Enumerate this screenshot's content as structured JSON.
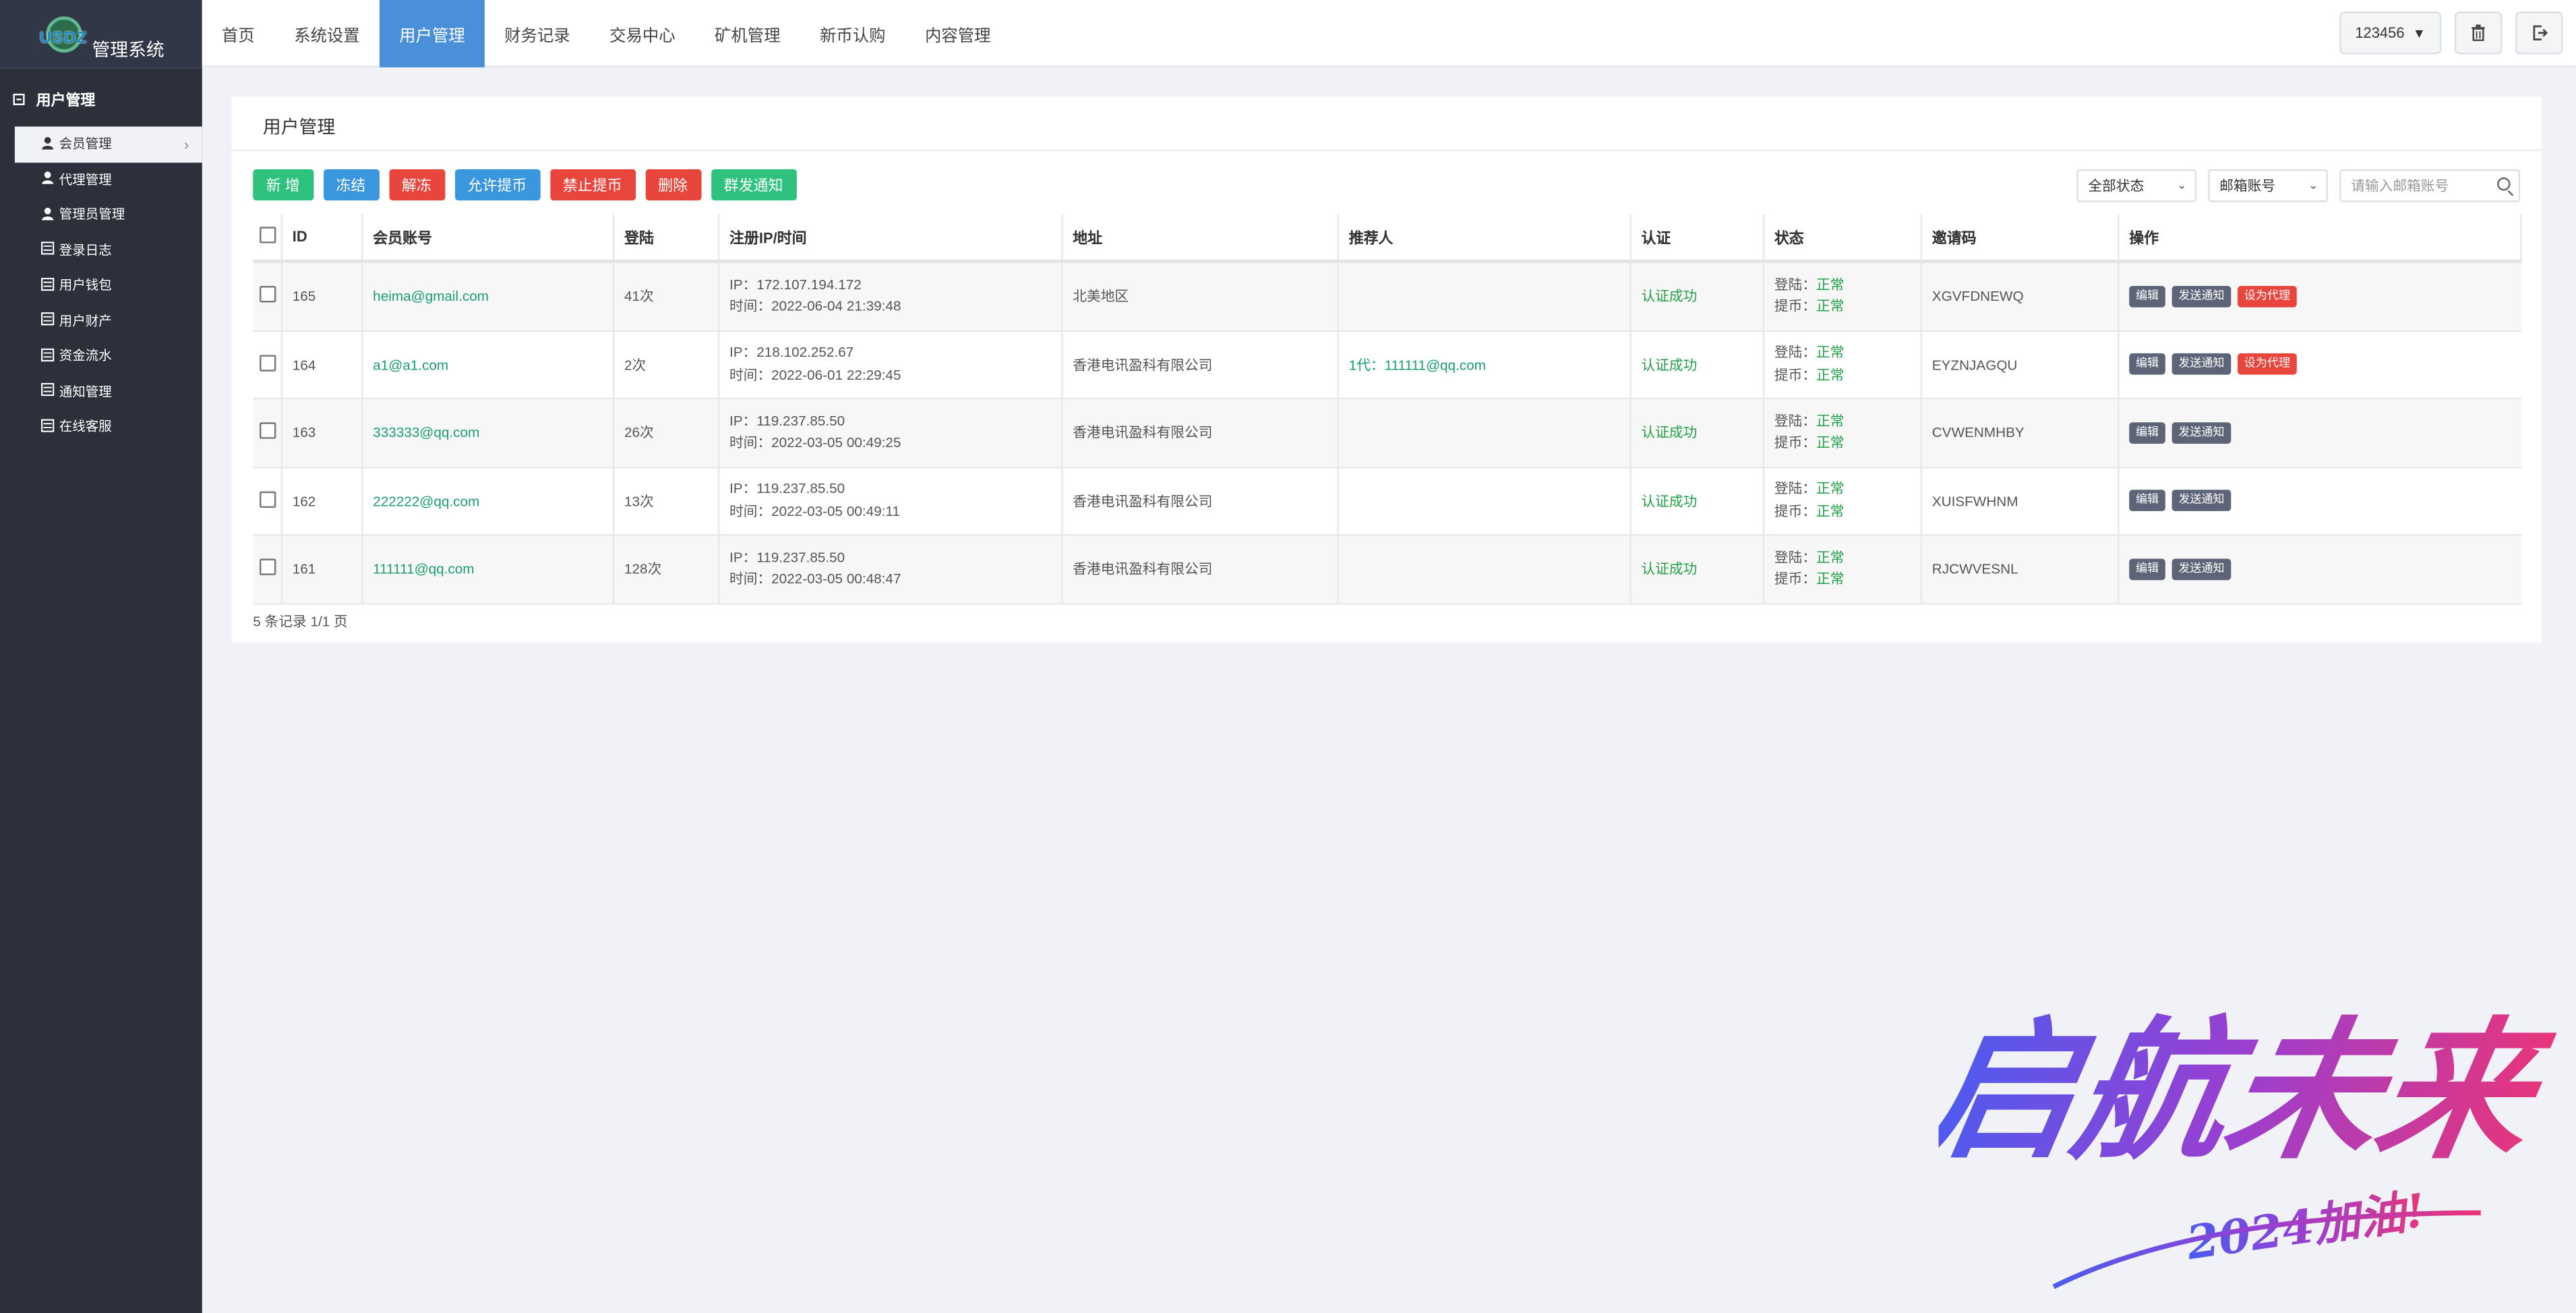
{
  "sidebar": {
    "logo_badge": "USDZ",
    "logo_title": "管理系统",
    "section": "用户管理",
    "items": [
      {
        "label": "会员管理",
        "icon": "user-icon",
        "active": true
      },
      {
        "label": "代理管理",
        "icon": "user-icon"
      },
      {
        "label": "管理员管理",
        "icon": "user-icon"
      },
      {
        "label": "登录日志",
        "icon": "list-icon"
      },
      {
        "label": "用户钱包",
        "icon": "list-icon"
      },
      {
        "label": "用户财产",
        "icon": "list-icon"
      },
      {
        "label": "资金流水",
        "icon": "list-icon"
      },
      {
        "label": "通知管理",
        "icon": "list-icon"
      },
      {
        "label": "在线客服",
        "icon": "list-icon"
      }
    ]
  },
  "topnav": {
    "items": [
      "首页",
      "系统设置",
      "用户管理",
      "财务记录",
      "交易中心",
      "矿机管理",
      "新币认购",
      "内容管理"
    ],
    "active": "用户管理",
    "user": "123456"
  },
  "panel": {
    "title": "用户管理",
    "toolbar": [
      {
        "label": "新 增",
        "color": "#2ec27e"
      },
      {
        "label": "冻结",
        "color": "#3a96dd"
      },
      {
        "label": "解冻",
        "color": "#e8453c"
      },
      {
        "label": "允许提币",
        "color": "#3a96dd"
      },
      {
        "label": "禁止提币",
        "color": "#e8453c"
      },
      {
        "label": "删除",
        "color": "#e8453c"
      },
      {
        "label": "群发通知",
        "color": "#2ec27e"
      }
    ],
    "filter_status": "全部状态",
    "filter_field": "邮箱账号",
    "search_placeholder": "请输入邮箱账号"
  },
  "table": {
    "headers": [
      "ID",
      "会员账号",
      "登陆",
      "注册IP/时间",
      "地址",
      "推荐人",
      "认证",
      "状态",
      "邀请码",
      "操作"
    ],
    "rows": [
      {
        "id": "165",
        "account": "heima@gmail.com",
        "logins": "41次",
        "ip": "IP：172.107.194.172",
        "time": "时间：2022-06-04 21:39:48",
        "address": "北美地区",
        "referrer": "",
        "auth": "认证成功",
        "login_label": "登陆：",
        "login_state": "正常",
        "withdraw_label": "提币：",
        "withdraw_state": "正常",
        "code": "XGVFDNEWQ",
        "actions": [
          "编辑",
          "发送通知",
          "设为代理"
        ]
      },
      {
        "id": "164",
        "account": "a1@a1.com",
        "logins": "2次",
        "ip": "IP：218.102.252.67",
        "time": "时间：2022-06-01 22:29:45",
        "address": "香港电讯盈科有限公司",
        "referrer": "1代：111111@qq.com",
        "auth": "认证成功",
        "login_label": "登陆：",
        "login_state": "正常",
        "withdraw_label": "提币：",
        "withdraw_state": "正常",
        "code": "EYZNJAGQU",
        "actions": [
          "编辑",
          "发送通知",
          "设为代理"
        ]
      },
      {
        "id": "163",
        "account": "333333@qq.com",
        "logins": "26次",
        "ip": "IP：119.237.85.50",
        "time": "时间：2022-03-05 00:49:25",
        "address": "香港电讯盈科有限公司",
        "referrer": "",
        "auth": "认证成功",
        "login_label": "登陆：",
        "login_state": "正常",
        "withdraw_label": "提币：",
        "withdraw_state": "正常",
        "code": "CVWENMHBY",
        "actions": [
          "编辑",
          "发送通知"
        ]
      },
      {
        "id": "162",
        "account": "222222@qq.com",
        "logins": "13次",
        "ip": "IP：119.237.85.50",
        "time": "时间：2022-03-05 00:49:11",
        "address": "香港电讯盈科有限公司",
        "referrer": "",
        "auth": "认证成功",
        "login_label": "登陆：",
        "login_state": "正常",
        "withdraw_label": "提币：",
        "withdraw_state": "正常",
        "code": "XUISFWHNM",
        "actions": [
          "编辑",
          "发送通知"
        ]
      },
      {
        "id": "161",
        "account": "111111@qq.com",
        "logins": "128次",
        "ip": "IP：119.237.85.50",
        "time": "时间：2022-03-05 00:48:47",
        "address": "香港电讯盈科有限公司",
        "referrer": "",
        "auth": "认证成功",
        "login_label": "登陆：",
        "login_state": "正常",
        "withdraw_label": "提币：",
        "withdraw_state": "正常",
        "code": "RJCWVESNL",
        "actions": [
          "编辑",
          "发送通知"
        ]
      }
    ],
    "footer": "5 条记录 1/1 页"
  },
  "watermark": {
    "main": "启航未来",
    "sub": "2024加油!",
    "colors": [
      "#4a5cf0",
      "#9a3fd0",
      "#e8357a"
    ]
  }
}
